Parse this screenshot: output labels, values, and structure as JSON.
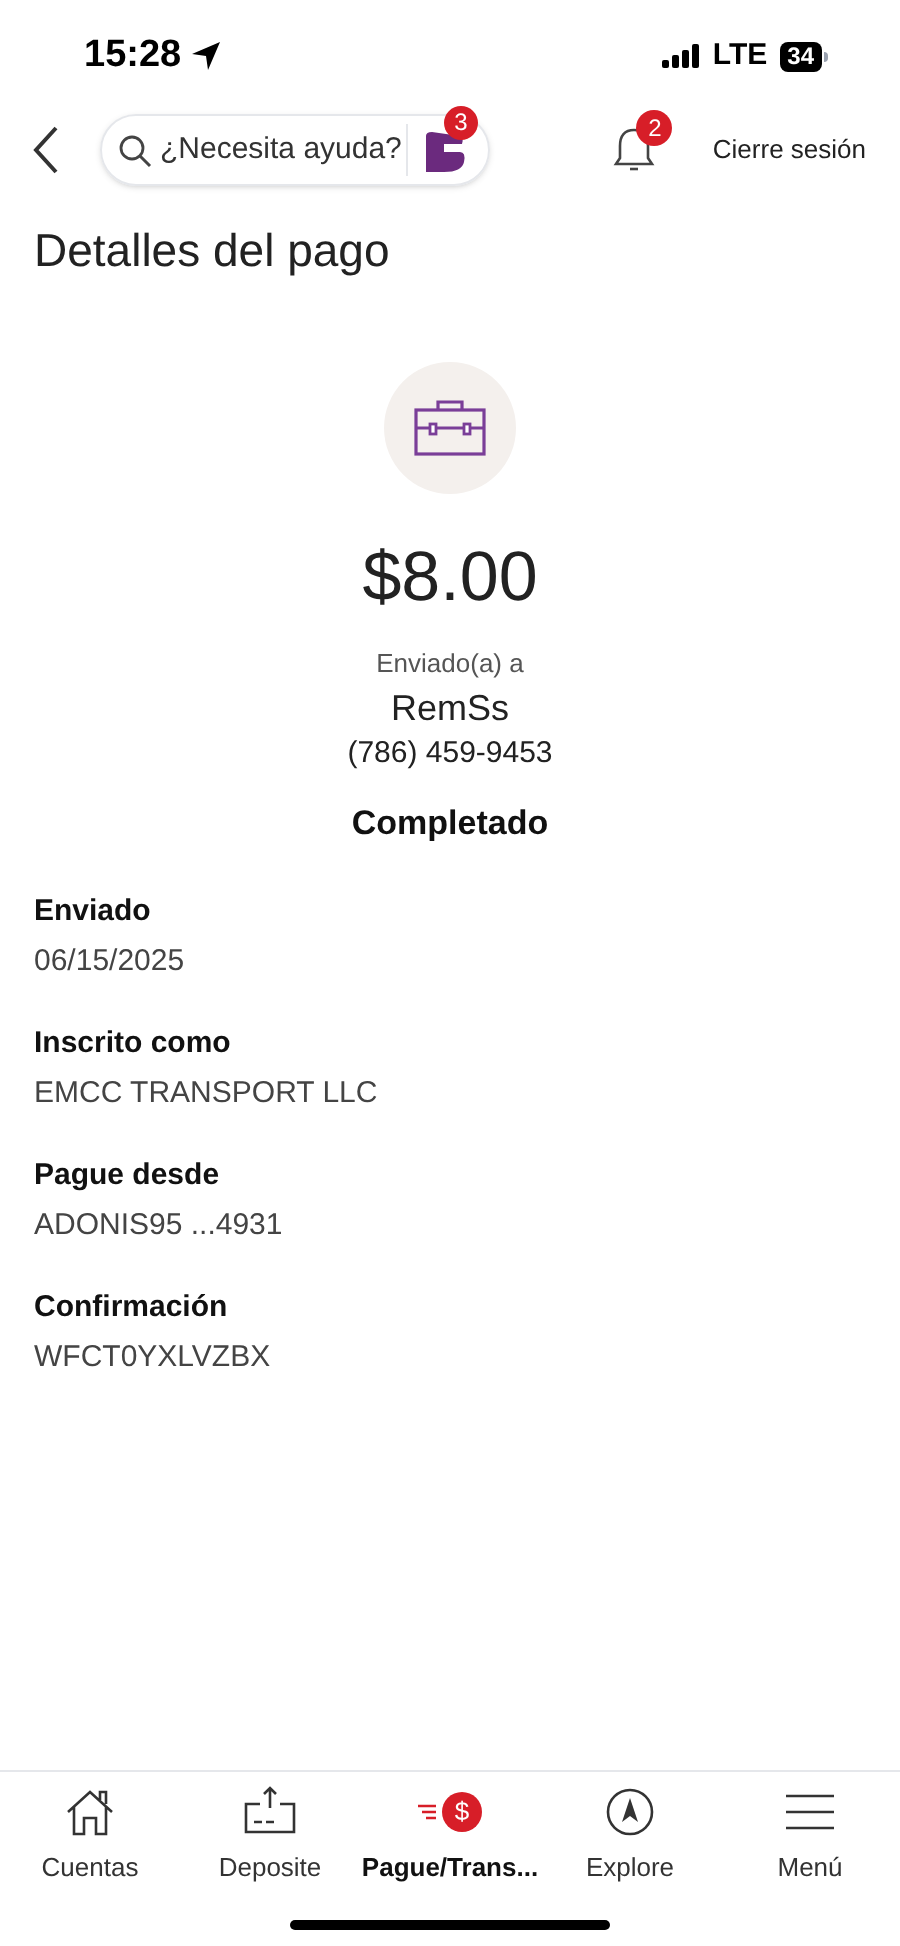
{
  "status_bar": {
    "time": "15:28",
    "network": "LTE",
    "battery": "34"
  },
  "top_bar": {
    "search": {
      "placeholder": "¿Necesita ayuda?"
    },
    "assistant_badge": "3",
    "notifications_badge": "2",
    "logout": "Cierre sesión"
  },
  "title": "Detalles del pago",
  "payment": {
    "amount": "$8.00",
    "sent_to_label": "Enviado(a) a",
    "recipient": "RemSs",
    "phone": "(786) 459-9453",
    "status": "Completado"
  },
  "details": [
    {
      "label": "Enviado",
      "value": "06/15/2025"
    },
    {
      "label": "Inscrito como",
      "value": "EMCC TRANSPORT LLC"
    },
    {
      "label": "Pague desde",
      "value": "ADONIS95 ...4931"
    },
    {
      "label": "Confirmación",
      "value": "WFCT0YXLVZBX"
    }
  ],
  "tab_bar": [
    {
      "kind": "home",
      "label": "Cuentas",
      "selected": false
    },
    {
      "kind": "deposit",
      "label": "Deposite",
      "selected": false
    },
    {
      "kind": "pay",
      "label": "Pague/Trans...",
      "selected": true,
      "icon_glyph": "$"
    },
    {
      "kind": "explore",
      "label": "Explore",
      "selected": false
    },
    {
      "kind": "menu",
      "label": "Menú",
      "selected": false
    }
  ]
}
